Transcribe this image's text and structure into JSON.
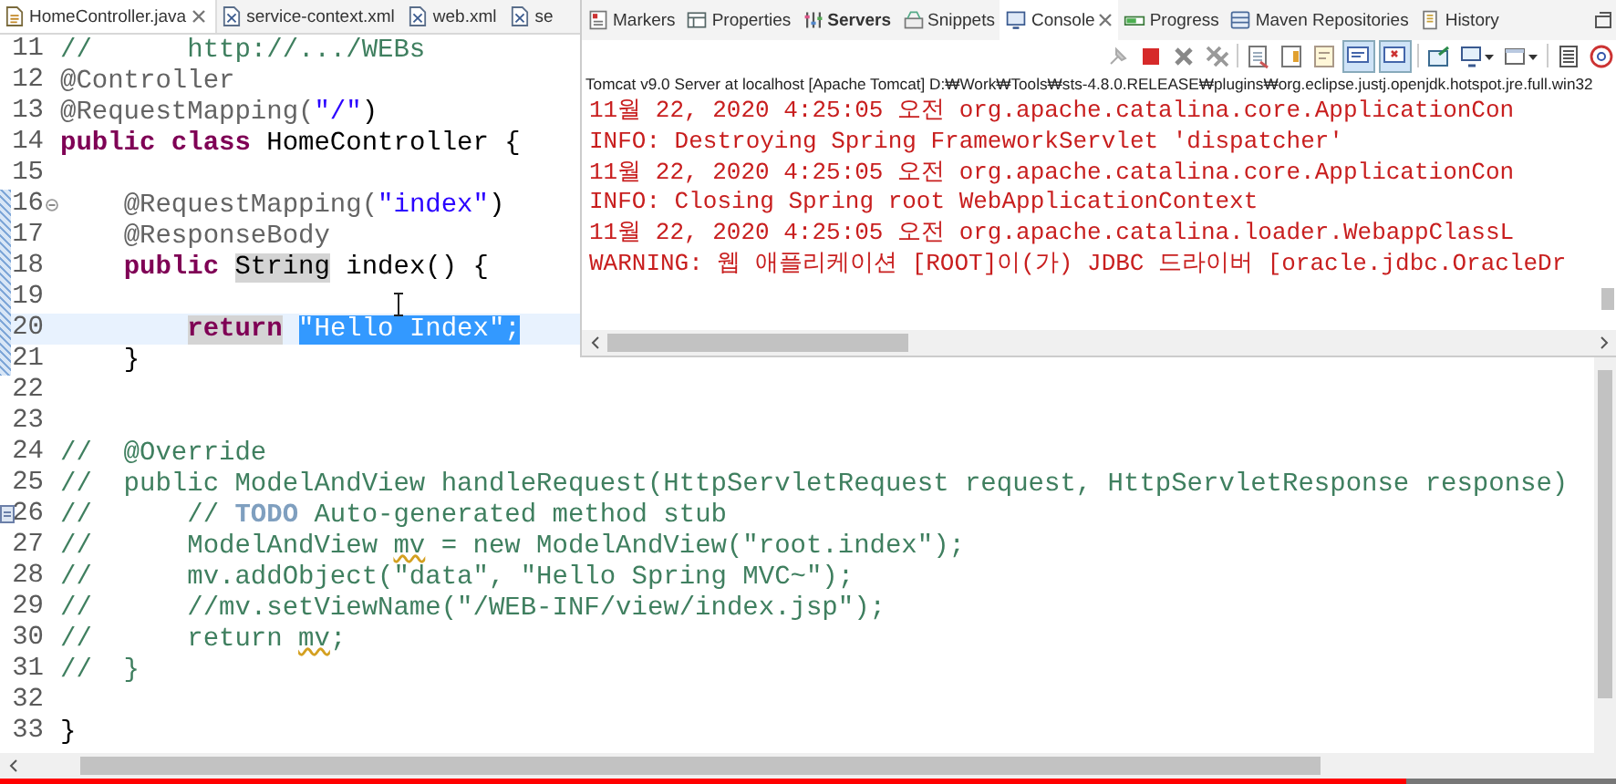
{
  "editor": {
    "tabs": [
      {
        "label": "HomeController.java",
        "selected": true,
        "closable": true
      },
      {
        "label": "service-context.xml",
        "selected": false,
        "closable": false
      },
      {
        "label": "web.xml",
        "selected": false,
        "closable": false
      },
      {
        "label": "se",
        "selected": false,
        "closable": false
      }
    ],
    "lines": [
      {
        "number": "11",
        "changed": false,
        "current": false,
        "segments": [
          {
            "kind": "comment",
            "text": "//      http://.../WEBs"
          }
        ]
      },
      {
        "number": "12",
        "changed": false,
        "current": false,
        "segments": [
          {
            "kind": "annotation",
            "text": "@Controller"
          }
        ]
      },
      {
        "number": "13",
        "changed": false,
        "current": false,
        "segments": [
          {
            "kind": "annotation",
            "text": "@RequestMapping("
          },
          {
            "kind": "string",
            "text": "\"/\""
          },
          {
            "kind": "plain",
            "text": ")"
          }
        ]
      },
      {
        "number": "14",
        "changed": false,
        "current": false,
        "segments": [
          {
            "kind": "keyword",
            "text": "public class"
          },
          {
            "kind": "plain",
            "text": " HomeController {"
          }
        ]
      },
      {
        "number": "15",
        "changed": false,
        "current": false
      },
      {
        "number": "16",
        "changed": true,
        "current": false,
        "fold": true,
        "segments": [
          {
            "kind": "annotation",
            "text": "    @RequestMapping("
          },
          {
            "kind": "string",
            "text": "\"index\""
          },
          {
            "kind": "plain",
            "text": ")"
          }
        ]
      },
      {
        "number": "17",
        "changed": true,
        "current": false,
        "segments": [
          {
            "kind": "annotation",
            "text": "    @ResponseBody"
          }
        ]
      },
      {
        "number": "18",
        "changed": true,
        "current": false,
        "segments": [
          {
            "kind": "keyword",
            "text": "    public "
          },
          {
            "kind": "plain",
            "text": "String",
            "occurrence": true
          },
          {
            "kind": "plain",
            "text": " index() {"
          }
        ]
      },
      {
        "number": "19",
        "changed": true,
        "current": false
      },
      {
        "number": "20",
        "changed": true,
        "current": true,
        "segments": [
          {
            "kind": "keyword",
            "text": "        return ",
            "occurrence": true
          },
          {
            "kind": "string",
            "text": "\"Hello Index\";",
            "selection": true
          }
        ]
      },
      {
        "number": "21",
        "changed": true,
        "current": false,
        "segments": [
          {
            "kind": "plain",
            "text": "    }"
          }
        ]
      },
      {
        "number": "22",
        "changed": false,
        "current": false
      },
      {
        "number": "23",
        "changed": false,
        "current": false
      },
      {
        "number": "24",
        "changed": false,
        "current": false,
        "segments": [
          {
            "kind": "comment",
            "text": "//  @Override"
          }
        ]
      },
      {
        "number": "25",
        "changed": false,
        "current": false,
        "segments": [
          {
            "kind": "comment",
            "text": "//  public ModelAndView handleRequest(HttpServletRequest request, HttpServletResponse response)"
          }
        ]
      },
      {
        "number": "26",
        "changed": false,
        "current": false,
        "task": true,
        "segments": [
          {
            "kind": "comment",
            "text": "//      // "
          },
          {
            "kind": "todo",
            "text": "TODO"
          },
          {
            "kind": "comment",
            "text": " Auto-generated method stub"
          }
        ]
      },
      {
        "number": "27",
        "changed": false,
        "current": false,
        "segments": [
          {
            "kind": "comment",
            "text": "//      ModelAndView "
          },
          {
            "kind": "comment",
            "text": "mv",
            "squiggle": true
          },
          {
            "kind": "comment",
            "text": " = new ModelAndView(\"root.index\");"
          }
        ]
      },
      {
        "number": "28",
        "changed": false,
        "current": false,
        "segments": [
          {
            "kind": "comment",
            "text": "//      mv.addObject(\"data\", \"Hello Spring MVC~\");"
          }
        ]
      },
      {
        "number": "29",
        "changed": false,
        "current": false,
        "segments": [
          {
            "kind": "comment",
            "text": "//      //mv.setViewName(\"/WEB-INF/view/index.jsp\");"
          }
        ]
      },
      {
        "number": "30",
        "changed": false,
        "current": false,
        "segments": [
          {
            "kind": "comment",
            "text": "//      return "
          },
          {
            "kind": "comment",
            "text": "mv",
            "squiggle": true
          },
          {
            "kind": "comment",
            "text": ";"
          }
        ]
      },
      {
        "number": "31",
        "changed": false,
        "current": false,
        "segments": [
          {
            "kind": "comment",
            "text": "//  }"
          }
        ]
      },
      {
        "number": "32",
        "changed": false,
        "current": false
      },
      {
        "number": "33",
        "changed": false,
        "current": false,
        "segments": [
          {
            "kind": "plain",
            "text": "}"
          }
        ]
      }
    ]
  },
  "console": {
    "tabs": [
      {
        "label": "Markers",
        "selected": false,
        "closable": false
      },
      {
        "label": "Properties",
        "selected": false,
        "closable": false
      },
      {
        "label": "Servers",
        "selected": false,
        "closable": false,
        "bold": true
      },
      {
        "label": "Snippets",
        "selected": false,
        "closable": false
      },
      {
        "label": "Console",
        "selected": true,
        "closable": true
      },
      {
        "label": "Progress",
        "selected": false,
        "closable": false
      },
      {
        "label": "Maven Repositories",
        "selected": false,
        "closable": false
      },
      {
        "label": "History",
        "selected": false,
        "closable": false
      }
    ],
    "process": "Tomcat v9.0 Server at localhost [Apache Tomcat] D:₩Work₩Tools₩sts-4.8.0.RELEASE₩plugins₩org.eclipse.justj.openjdk.hotspot.jre.full.win32",
    "lines": [
      "11월 22, 2020 4:25:05 오전 org.apache.catalina.core.ApplicationCon",
      "INFO: Destroying Spring FrameworkServlet 'dispatcher'",
      "11월 22, 2020 4:25:05 오전 org.apache.catalina.core.ApplicationCon",
      "INFO: Closing Spring root WebApplicationContext",
      "11월 22, 2020 4:25:05 오전 org.apache.catalina.loader.WebappClassL",
      "WARNING: 웹 애플리케이션 [ROOT]이(가) JDBC 드라이버 [oracle.jdbc.OracleDr"
    ]
  },
  "video_progress": {
    "level": 0.87
  }
}
